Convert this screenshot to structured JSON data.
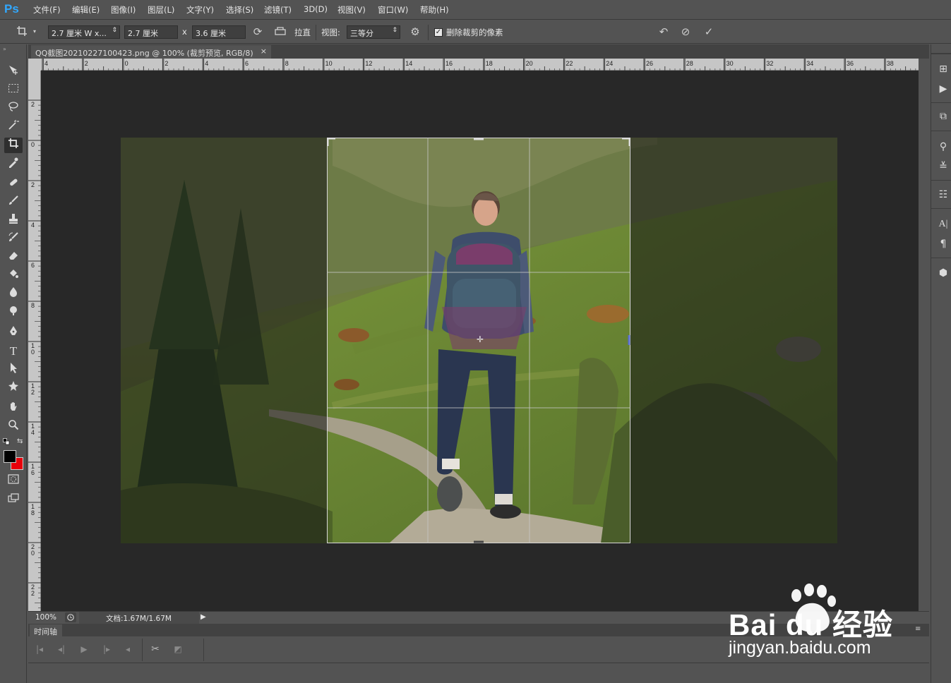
{
  "app": {
    "logo": "Ps"
  },
  "menu": [
    "文件(F)",
    "编辑(E)",
    "图像(I)",
    "图层(L)",
    "文字(Y)",
    "选择(S)",
    "滤镜(T)",
    "3D(D)",
    "视图(V)",
    "窗口(W)",
    "帮助(H)"
  ],
  "options": {
    "preset": "2.7 厘米 W x...",
    "width": "2.7 厘米",
    "x_sep": "x",
    "height": "3.6 厘米",
    "straighten": "拉直",
    "view_label": "视图:",
    "view_value": "三等分",
    "delete_cropped_label": "删除裁剪的像素",
    "delete_cropped_checked": true
  },
  "document": {
    "tab_title": "QQ截图20210227100423.png @ 100% (裁剪预览, RGB/8)",
    "tab_close": "×"
  },
  "ruler": {
    "top_labels": [
      "4",
      "2",
      "0",
      "2",
      "4",
      "6",
      "8",
      "10",
      "12",
      "14",
      "16",
      "18",
      "20",
      "22",
      "24",
      "26",
      "28",
      "30",
      "32",
      "34",
      "36",
      "38"
    ],
    "left_labels": [
      "2",
      "0",
      "2",
      "4",
      "6",
      "8",
      "10",
      "12",
      "14",
      "16",
      "18",
      "20",
      "22"
    ]
  },
  "status": {
    "zoom": "100%",
    "doc_info": "文档:1.67M/1.67M"
  },
  "timeline": {
    "tab_label": "时间轴"
  },
  "watermark": {
    "brand": "Bai du 经验",
    "url": "jingyan.baidu.com"
  },
  "colors": {
    "foreground": "#000000",
    "background": "#e8000b",
    "accent": "#31a8ff"
  },
  "tools": [
    "move-icon",
    "marquee-icon",
    "lasso-icon",
    "magic-wand-icon",
    "crop-icon",
    "eyedropper-icon",
    "healing-brush-icon",
    "brush-icon",
    "clone-stamp-icon",
    "history-brush-icon",
    "eraser-icon",
    "paint-bucket-icon",
    "blur-icon",
    "dodge-icon",
    "pen-icon",
    "type-icon",
    "path-selection-icon",
    "shape-icon",
    "hand-icon",
    "zoom-icon"
  ]
}
